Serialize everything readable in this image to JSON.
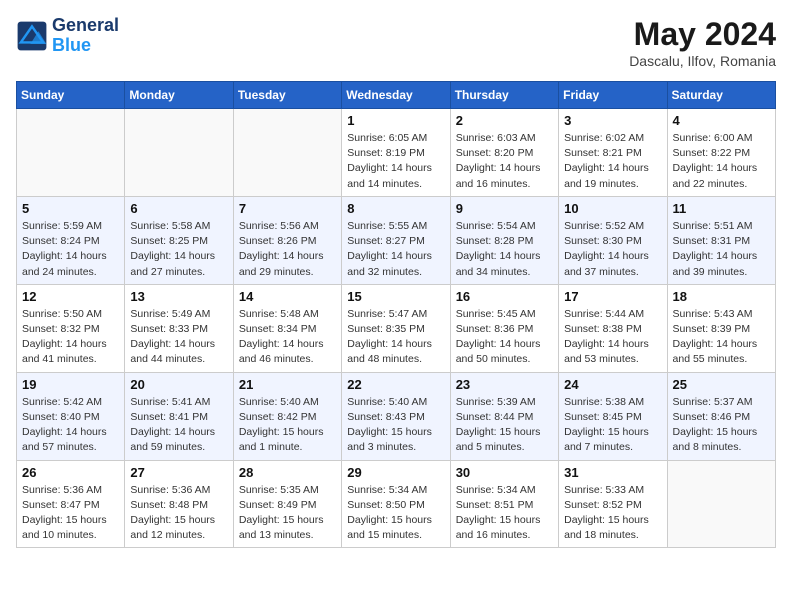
{
  "header": {
    "logo_line1": "General",
    "logo_line2": "Blue",
    "month": "May 2024",
    "location": "Dascalu, Ilfov, Romania"
  },
  "days_of_week": [
    "Sunday",
    "Monday",
    "Tuesday",
    "Wednesday",
    "Thursday",
    "Friday",
    "Saturday"
  ],
  "weeks": [
    [
      {
        "day": "",
        "info": ""
      },
      {
        "day": "",
        "info": ""
      },
      {
        "day": "",
        "info": ""
      },
      {
        "day": "1",
        "info": "Sunrise: 6:05 AM\nSunset: 8:19 PM\nDaylight: 14 hours\nand 14 minutes."
      },
      {
        "day": "2",
        "info": "Sunrise: 6:03 AM\nSunset: 8:20 PM\nDaylight: 14 hours\nand 16 minutes."
      },
      {
        "day": "3",
        "info": "Sunrise: 6:02 AM\nSunset: 8:21 PM\nDaylight: 14 hours\nand 19 minutes."
      },
      {
        "day": "4",
        "info": "Sunrise: 6:00 AM\nSunset: 8:22 PM\nDaylight: 14 hours\nand 22 minutes."
      }
    ],
    [
      {
        "day": "5",
        "info": "Sunrise: 5:59 AM\nSunset: 8:24 PM\nDaylight: 14 hours\nand 24 minutes."
      },
      {
        "day": "6",
        "info": "Sunrise: 5:58 AM\nSunset: 8:25 PM\nDaylight: 14 hours\nand 27 minutes."
      },
      {
        "day": "7",
        "info": "Sunrise: 5:56 AM\nSunset: 8:26 PM\nDaylight: 14 hours\nand 29 minutes."
      },
      {
        "day": "8",
        "info": "Sunrise: 5:55 AM\nSunset: 8:27 PM\nDaylight: 14 hours\nand 32 minutes."
      },
      {
        "day": "9",
        "info": "Sunrise: 5:54 AM\nSunset: 8:28 PM\nDaylight: 14 hours\nand 34 minutes."
      },
      {
        "day": "10",
        "info": "Sunrise: 5:52 AM\nSunset: 8:30 PM\nDaylight: 14 hours\nand 37 minutes."
      },
      {
        "day": "11",
        "info": "Sunrise: 5:51 AM\nSunset: 8:31 PM\nDaylight: 14 hours\nand 39 minutes."
      }
    ],
    [
      {
        "day": "12",
        "info": "Sunrise: 5:50 AM\nSunset: 8:32 PM\nDaylight: 14 hours\nand 41 minutes."
      },
      {
        "day": "13",
        "info": "Sunrise: 5:49 AM\nSunset: 8:33 PM\nDaylight: 14 hours\nand 44 minutes."
      },
      {
        "day": "14",
        "info": "Sunrise: 5:48 AM\nSunset: 8:34 PM\nDaylight: 14 hours\nand 46 minutes."
      },
      {
        "day": "15",
        "info": "Sunrise: 5:47 AM\nSunset: 8:35 PM\nDaylight: 14 hours\nand 48 minutes."
      },
      {
        "day": "16",
        "info": "Sunrise: 5:45 AM\nSunset: 8:36 PM\nDaylight: 14 hours\nand 50 minutes."
      },
      {
        "day": "17",
        "info": "Sunrise: 5:44 AM\nSunset: 8:38 PM\nDaylight: 14 hours\nand 53 minutes."
      },
      {
        "day": "18",
        "info": "Sunrise: 5:43 AM\nSunset: 8:39 PM\nDaylight: 14 hours\nand 55 minutes."
      }
    ],
    [
      {
        "day": "19",
        "info": "Sunrise: 5:42 AM\nSunset: 8:40 PM\nDaylight: 14 hours\nand 57 minutes."
      },
      {
        "day": "20",
        "info": "Sunrise: 5:41 AM\nSunset: 8:41 PM\nDaylight: 14 hours\nand 59 minutes."
      },
      {
        "day": "21",
        "info": "Sunrise: 5:40 AM\nSunset: 8:42 PM\nDaylight: 15 hours\nand 1 minute."
      },
      {
        "day": "22",
        "info": "Sunrise: 5:40 AM\nSunset: 8:43 PM\nDaylight: 15 hours\nand 3 minutes."
      },
      {
        "day": "23",
        "info": "Sunrise: 5:39 AM\nSunset: 8:44 PM\nDaylight: 15 hours\nand 5 minutes."
      },
      {
        "day": "24",
        "info": "Sunrise: 5:38 AM\nSunset: 8:45 PM\nDaylight: 15 hours\nand 7 minutes."
      },
      {
        "day": "25",
        "info": "Sunrise: 5:37 AM\nSunset: 8:46 PM\nDaylight: 15 hours\nand 8 minutes."
      }
    ],
    [
      {
        "day": "26",
        "info": "Sunrise: 5:36 AM\nSunset: 8:47 PM\nDaylight: 15 hours\nand 10 minutes."
      },
      {
        "day": "27",
        "info": "Sunrise: 5:36 AM\nSunset: 8:48 PM\nDaylight: 15 hours\nand 12 minutes."
      },
      {
        "day": "28",
        "info": "Sunrise: 5:35 AM\nSunset: 8:49 PM\nDaylight: 15 hours\nand 13 minutes."
      },
      {
        "day": "29",
        "info": "Sunrise: 5:34 AM\nSunset: 8:50 PM\nDaylight: 15 hours\nand 15 minutes."
      },
      {
        "day": "30",
        "info": "Sunrise: 5:34 AM\nSunset: 8:51 PM\nDaylight: 15 hours\nand 16 minutes."
      },
      {
        "day": "31",
        "info": "Sunrise: 5:33 AM\nSunset: 8:52 PM\nDaylight: 15 hours\nand 18 minutes."
      },
      {
        "day": "",
        "info": ""
      }
    ]
  ]
}
